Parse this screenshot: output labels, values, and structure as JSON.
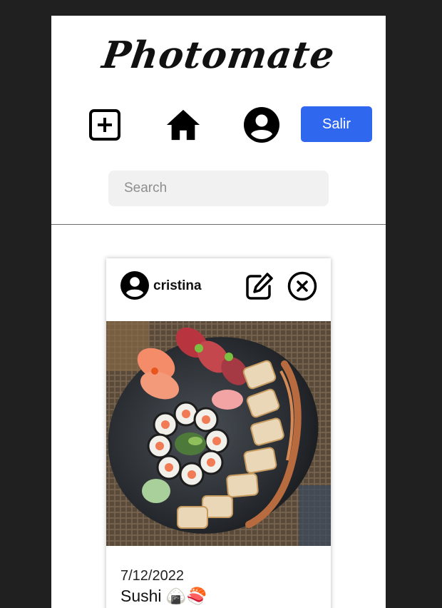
{
  "app": {
    "logo": "Photomate"
  },
  "nav": {
    "add_icon": "add-square-icon",
    "home_icon": "home-icon",
    "profile_icon": "account-circle-icon",
    "logout_label": "Salir"
  },
  "search": {
    "placeholder": "Search",
    "value": ""
  },
  "post": {
    "username": "cristina",
    "avatar_icon": "account-circle-icon",
    "edit_icon": "edit-icon",
    "delete_icon": "close-circle-icon",
    "photo_subject": "sushi-platter-photo",
    "date": "7/12/2022",
    "title": "Sushi 🍙🍣"
  },
  "colors": {
    "background": "#202020",
    "panel": "#ffffff",
    "accent": "#2f67ee",
    "search_bg": "#f1f1f1"
  }
}
